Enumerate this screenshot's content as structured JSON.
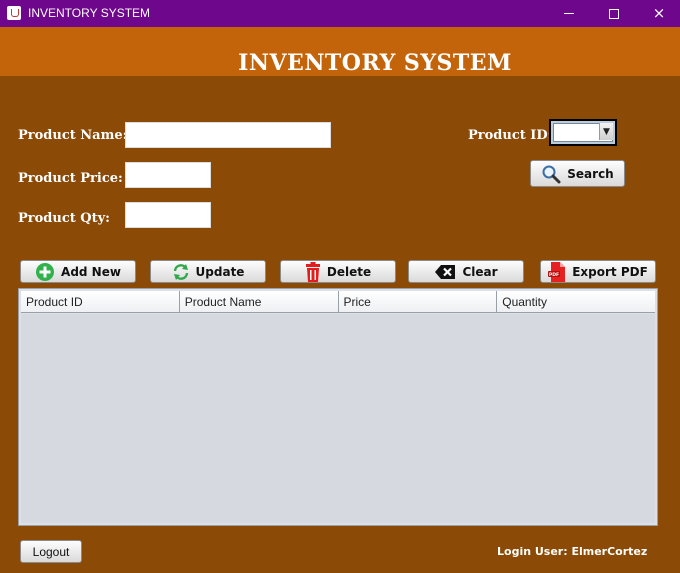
{
  "window": {
    "title": "INVENTORY SYSTEM",
    "icon": "java-cup-icon",
    "controls": {
      "minimize": "minimize-icon",
      "maximize": "maximize-icon",
      "close": "×"
    }
  },
  "header": {
    "title": "INVENTORY SYSTEM",
    "background": "#C4640A"
  },
  "form": {
    "product_name_label": "Product Name:",
    "product_name_value": "",
    "product_price_label": "Product Price:",
    "product_price_value": "",
    "product_qty_label": "Product Qty:",
    "product_qty_value": "",
    "product_id_label": "Product ID:",
    "product_id_selected": ""
  },
  "actions": {
    "search_label": "Search",
    "add_new_label": "Add New",
    "update_label": "Update",
    "delete_label": "Delete",
    "clear_label": "Clear",
    "export_pdf_label": "Export PDF"
  },
  "table": {
    "columns": [
      "Product ID",
      "Product Name",
      "Price",
      "Quantity"
    ],
    "rows": []
  },
  "footer": {
    "logout_label": "Logout",
    "login_user": "Login User: ElmerCortez"
  },
  "colors": {
    "titlebar": "#6E078C",
    "panel": "#8B4A06",
    "banner": "#C4640A",
    "table_bg": "#D6D9DF"
  }
}
